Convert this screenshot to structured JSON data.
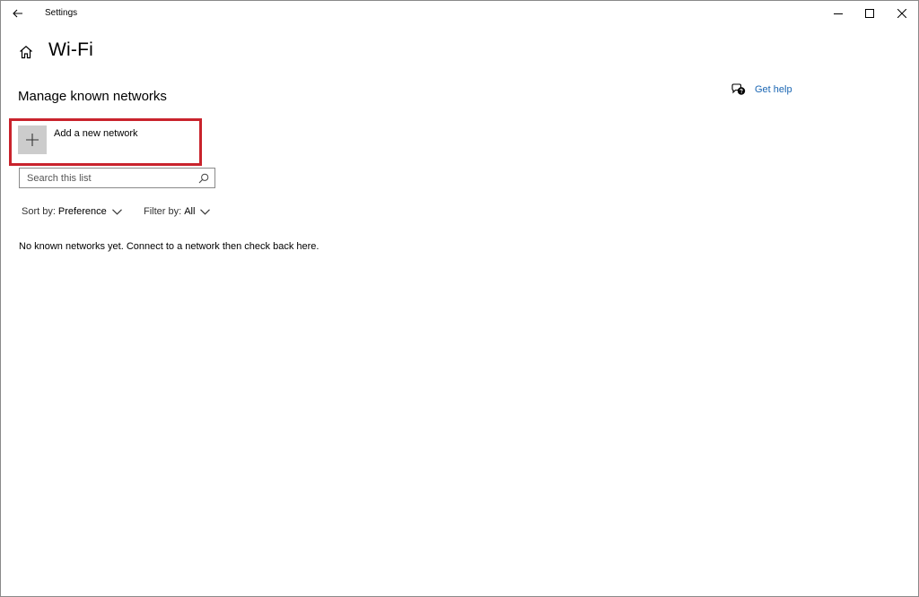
{
  "window": {
    "title": "Settings"
  },
  "page": {
    "title": "Wi-Fi",
    "section_title": "Manage known networks"
  },
  "help": {
    "label": "Get help",
    "icon": "chat-help-icon"
  },
  "add_network": {
    "label": "Add a new network",
    "icon": "plus-icon",
    "highlight_color": "#c9232c"
  },
  "search": {
    "placeholder": "Search this list",
    "value": ""
  },
  "sort": {
    "prefix": "Sort by:",
    "value": "Preference"
  },
  "filter": {
    "prefix": "Filter by:",
    "value": "All"
  },
  "empty_message": "No known networks yet. Connect to a network then check back here.",
  "colors": {
    "accent": "#1a66b3",
    "tile": "#cccccc"
  }
}
